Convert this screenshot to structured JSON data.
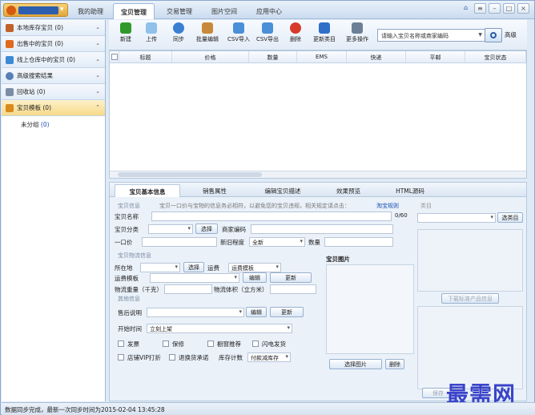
{
  "top_tabs": [
    "我的助理",
    "宝贝管理",
    "交易管理",
    "图片空间",
    "应用中心"
  ],
  "sidebar": {
    "items": [
      {
        "label": "本地库存宝贝 (0)",
        "color": "#c0622a"
      },
      {
        "label": "出售中的宝贝 (0)",
        "color": "#e06a20"
      },
      {
        "label": "线上仓库中的宝贝 (0)",
        "color": "#3d8bd6"
      },
      {
        "label": "高级搜索结果",
        "color": "#5a7fb5"
      },
      {
        "label": "回收站 (0)",
        "color": "#7c8ea6"
      },
      {
        "label": "宝贝模板 (0)",
        "color": "#d98a1a"
      }
    ],
    "subitem": {
      "label": "未分组",
      "count": "(0)"
    }
  },
  "toolbar": {
    "buttons": [
      "新建",
      "上传",
      "同步",
      "批量编辑",
      "CSV导入",
      "CSV导出",
      "删除",
      "更新类目",
      "更多操作"
    ],
    "search_placeholder": "请输入宝贝名称或商家编码",
    "advanced": "高级"
  },
  "grid": {
    "columns": [
      "标题",
      "价格",
      "数量",
      "EMS",
      "快递",
      "平邮",
      "宝贝状态"
    ]
  },
  "lower": {
    "tabs": [
      "宝贝基本信息",
      "销售属性",
      "编辑宝贝描述",
      "效果预览",
      "HTML源码"
    ],
    "section_info": "宝贝信息",
    "tip": "宝贝一口价与宝物的信息务必相符，以避免您的宝贝违规，相关规定请点击：",
    "tip_link": "淘宝规则",
    "category": "类目",
    "select_category": "选类目",
    "name_label": "宝贝名称",
    "name_count": "0/60",
    "class_label": "宝贝分类",
    "select_btn": "选择",
    "merchant_code": "商家编码",
    "price_label": "一口价",
    "condition_label": "新旧程度",
    "condition_value": "全新",
    "qty_label": "数量",
    "section_logistics": "宝贝物流信息",
    "location_label": "所在地",
    "location_select": "选择",
    "freight_label": "运费",
    "freight_value": "运费模板",
    "freight_tpl_label": "运费模板",
    "edit_btn": "编辑",
    "update_btn": "更新",
    "weight_label": "物流重量（千克）",
    "volume_label": "物流体积（立方米）",
    "images_label": "宝贝图片",
    "select_image": "选择图片",
    "delete_image": "删除",
    "download_std": "下载标准产品信息",
    "section_other": "其他信息",
    "after_sale": "售后说明",
    "edit2": "编辑",
    "update2": "更新",
    "start_time": "开始时间",
    "start_value": "立刻上架",
    "invoice": "发票",
    "warranty": "保修",
    "recommend": "橱窗推荐",
    "flash": "闪电发货",
    "vip": "店铺VIP打折",
    "exchange": "退换货承诺",
    "stock_count": "库存计数",
    "stock_value": "付款减库存",
    "save": "保存"
  },
  "status": "数据同步完成，最新一次同步时间为2015-02-04 13:45:28",
  "watermark": "最需网"
}
